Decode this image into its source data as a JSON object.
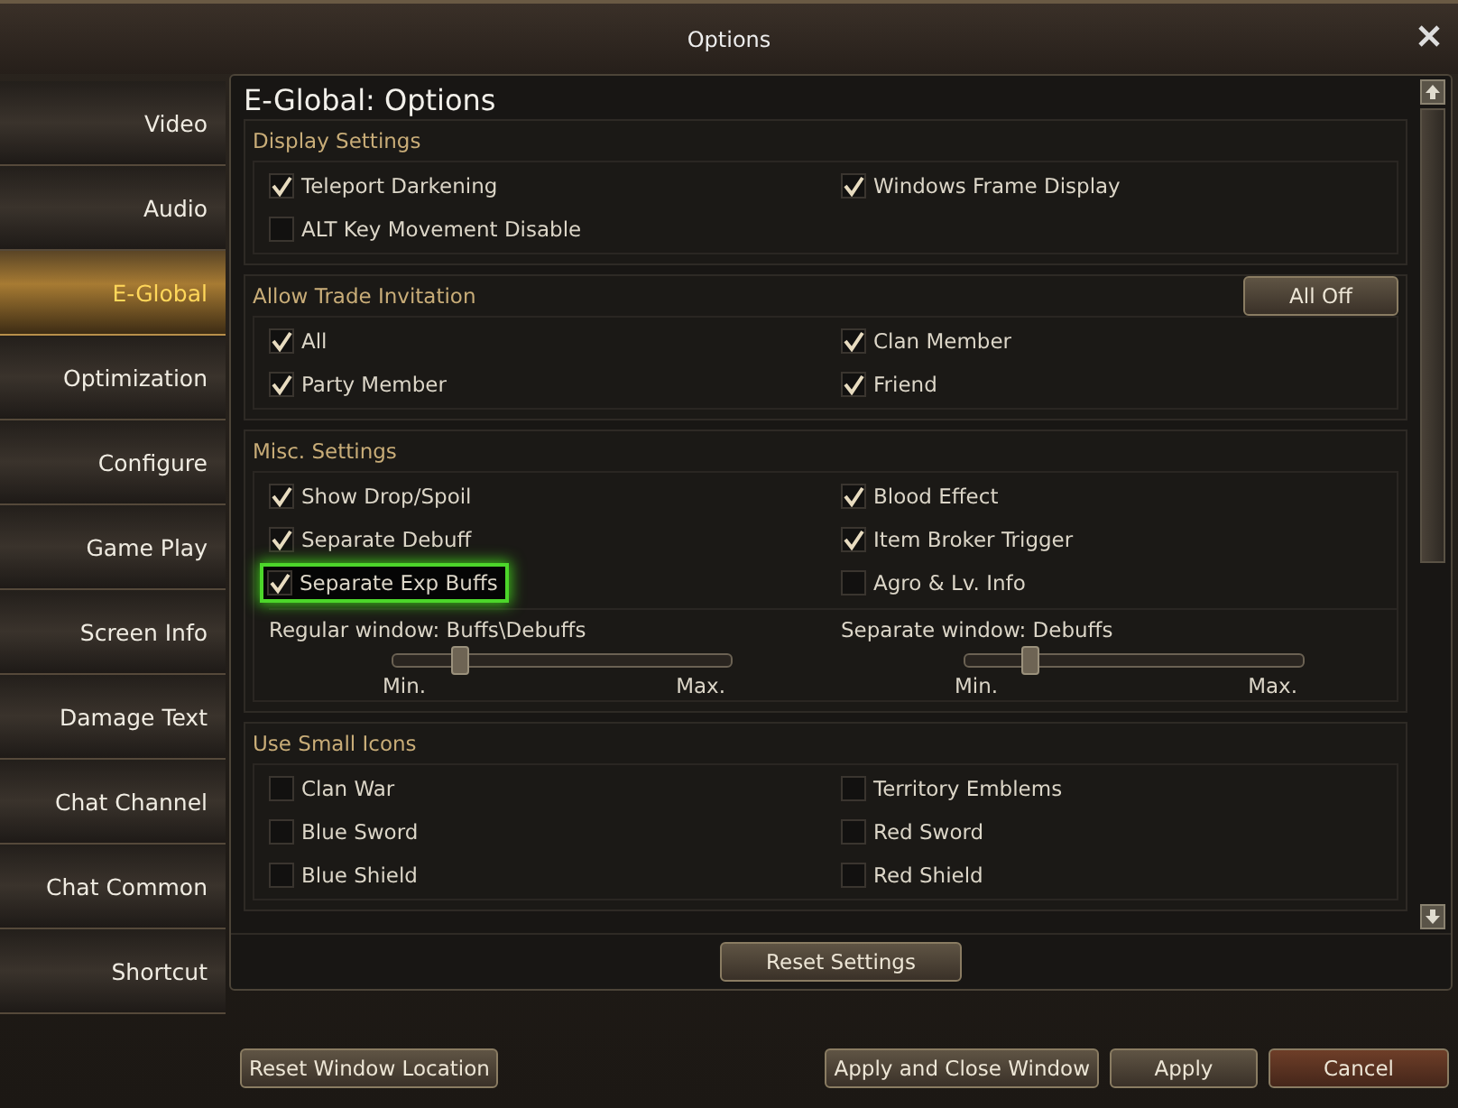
{
  "window": {
    "title": "Options"
  },
  "sidebar": {
    "items": [
      {
        "label": "Video",
        "selected": false
      },
      {
        "label": "Audio",
        "selected": false
      },
      {
        "label": "E-Global",
        "selected": true
      },
      {
        "label": "Optimization",
        "selected": false
      },
      {
        "label": "Configure",
        "selected": false
      },
      {
        "label": "Game Play",
        "selected": false
      },
      {
        "label": "Screen Info",
        "selected": false
      },
      {
        "label": "Damage Text",
        "selected": false
      },
      {
        "label": "Chat Channel",
        "selected": false
      },
      {
        "label": "Chat Common",
        "selected": false
      },
      {
        "label": "Shortcut",
        "selected": false
      }
    ]
  },
  "panel": {
    "title": "E-Global: Options",
    "sections": [
      {
        "title": "Display Settings",
        "options": [
          {
            "label": "Teleport Darkening",
            "checked": true,
            "highlighted": false
          },
          {
            "label": "Windows Frame Display",
            "checked": true,
            "highlighted": false
          },
          {
            "label": "ALT Key Movement Disable",
            "checked": false,
            "highlighted": false
          }
        ]
      },
      {
        "title": "Allow Trade Invitation",
        "button": "All Off",
        "options": [
          {
            "label": "All",
            "checked": true,
            "highlighted": false
          },
          {
            "label": "Clan Member",
            "checked": true,
            "highlighted": false
          },
          {
            "label": "Party Member",
            "checked": true,
            "highlighted": false
          },
          {
            "label": "Friend",
            "checked": true,
            "highlighted": false
          }
        ]
      },
      {
        "title": "Misc. Settings",
        "options": [
          {
            "label": "Show Drop/Spoil",
            "checked": true,
            "highlighted": false
          },
          {
            "label": "Blood Effect",
            "checked": true,
            "highlighted": false
          },
          {
            "label": "Separate Debuff",
            "checked": true,
            "highlighted": false
          },
          {
            "label": "Item Broker Trigger",
            "checked": true,
            "highlighted": false
          },
          {
            "label": "Separate Exp Buffs",
            "checked": true,
            "highlighted": true
          },
          {
            "label": "Agro & Lv. Info",
            "checked": false,
            "highlighted": false
          }
        ],
        "sliders": [
          {
            "label": "Regular window: Buffs\\Debuffs",
            "min": "Min.",
            "max": "Max.",
            "level": 0.2
          },
          {
            "label": "Separate window: Debuffs",
            "min": "Min.",
            "max": "Max.",
            "level": 0.19
          }
        ]
      },
      {
        "title": "Use Small Icons",
        "options": [
          {
            "label": "Clan War",
            "checked": false,
            "highlighted": false
          },
          {
            "label": "Territory Emblems",
            "checked": false,
            "highlighted": false
          },
          {
            "label": "Blue Sword",
            "checked": false,
            "highlighted": false
          },
          {
            "label": "Red Sword",
            "checked": false,
            "highlighted": false
          },
          {
            "label": "Blue Shield",
            "checked": false,
            "highlighted": false
          },
          {
            "label": "Red Shield",
            "checked": false,
            "highlighted": false
          }
        ]
      }
    ],
    "reset_button": "Reset Settings"
  },
  "buttons": [
    {
      "label": "Reset Window Location",
      "kind": "normal"
    },
    {
      "label": "Apply and Close Window",
      "kind": "normal"
    },
    {
      "label": "Apply",
      "kind": "normal"
    },
    {
      "label": "Cancel",
      "kind": "cancel"
    }
  ]
}
